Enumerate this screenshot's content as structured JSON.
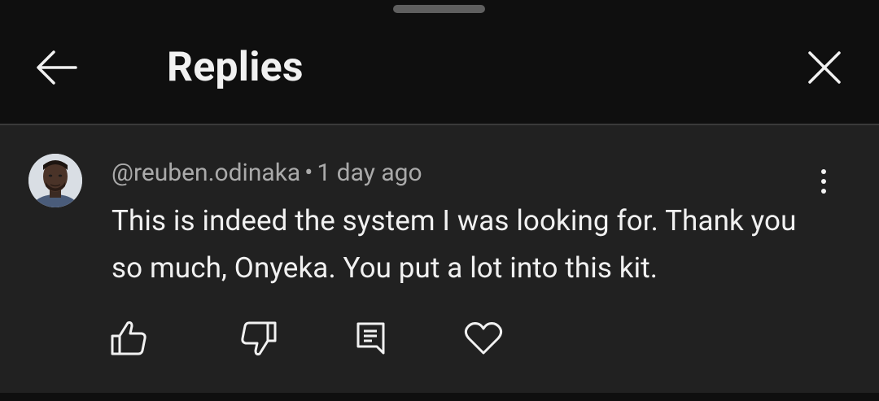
{
  "header": {
    "title": "Replies",
    "back_icon": "arrow-left-icon",
    "close_icon": "close-icon"
  },
  "comment": {
    "handle": "@reuben.odinaka",
    "separator": "•",
    "time": "1 day ago",
    "text": "This is indeed the system I was looking for. Thank you so much, Onyeka. You put a lot into this kit.",
    "avatar_icon": "avatar-photo",
    "more_icon": "more-vertical-icon"
  },
  "actions": [
    {
      "name": "like",
      "icon": "thumbs-up-icon"
    },
    {
      "name": "dislike",
      "icon": "thumbs-down-icon"
    },
    {
      "name": "reply",
      "icon": "comment-icon"
    },
    {
      "name": "heart",
      "icon": "heart-icon"
    }
  ],
  "colors": {
    "background": "#0f0f0f",
    "panel": "#212121",
    "text_primary": "#f1f1f1",
    "text_secondary": "#aaaaaa"
  }
}
